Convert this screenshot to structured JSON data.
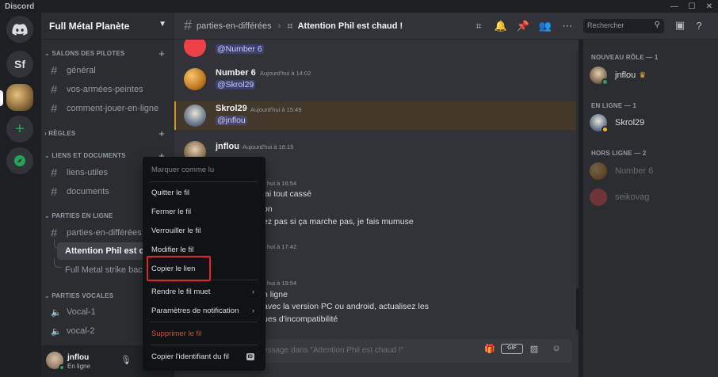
{
  "app": {
    "name": "Discord"
  },
  "window_controls": [
    "—",
    "☐",
    "✕"
  ],
  "rail": {
    "home_icon": "discord-logo-icon",
    "servers": [
      {
        "initials": "Sf"
      },
      {
        "initials": ""
      }
    ],
    "add_icon": "+",
    "explore_icon": "compass-icon"
  },
  "guild": {
    "name": "Full Métal Planète"
  },
  "categories": [
    {
      "label": "SALONS DES PILOTES"
    },
    {
      "label": "RÈGLES"
    },
    {
      "label": "LIENS ET DOCUMENTS"
    },
    {
      "label": "PARTIES EN LIGNE"
    },
    {
      "label": "PARTIES VOCALES"
    }
  ],
  "channels": {
    "pilotes": [
      "général",
      "vos-armées-peintes",
      "comment-jouer-en-ligne"
    ],
    "liens": [
      "liens-utiles",
      "documents"
    ],
    "parties": [
      "parties-en-différées"
    ],
    "threads": [
      "Attention Phil est chaud !",
      "Full Metal strike back"
    ],
    "vocal": [
      "Vocal-1",
      "vocal-2"
    ]
  },
  "user": {
    "name": "jnflou",
    "status": "En ligne"
  },
  "header": {
    "parent_channel": "parties-en-différées",
    "thread_title": "Attention Phil est chaud !",
    "search_placeholder": "Rechercher"
  },
  "messages": [
    {
      "author": "",
      "time": "",
      "text": "@Number 6",
      "mention": true
    },
    {
      "author": "Number 6",
      "time": "Aujourd'hui à 14:02",
      "text": "@Skrol29",
      "mention": true
    },
    {
      "author": "Skrol29",
      "time": "Aujourd'hui à 15:49",
      "text": "@jnflou",
      "mention": true
    },
    {
      "author": "jnflou",
      "time": "Aujourd'hui à 16:15",
      "text": "",
      "mention": false
    }
  ],
  "partial_messages": [
    {
      "time": "hui à 16:54"
    },
    {
      "text": "'ai tout cassé"
    },
    {
      "text": "on"
    },
    {
      "text": "ez pas si ça marche pas, je fais mumuse"
    },
    {
      "time": "hui à 17:42"
    },
    {
      "time": "hui à 19:54"
    },
    {
      "text": "n ligne"
    },
    {
      "text": "avec la version PC ou android, actualisez les"
    },
    {
      "text": "ues d'incompatibilité"
    }
  ],
  "composer": {
    "placeholder": "essage dans \"Attention Phil est chaud !\""
  },
  "members": {
    "groups": [
      {
        "label": "NOUVEAU RÔLE — 1",
        "members": [
          {
            "name": "jnflou"
          }
        ]
      },
      {
        "label": "EN LIGNE — 1",
        "members": [
          {
            "name": "Skrol29"
          }
        ]
      },
      {
        "label": "HORS LIGNE — 2",
        "members": [
          {
            "name": "Number 6"
          },
          {
            "name": "seikovag"
          }
        ]
      }
    ]
  },
  "context_menu": {
    "items": [
      {
        "label": "Marquer comme lu",
        "type": "disabled"
      },
      {
        "label": "Quitter le fil"
      },
      {
        "label": "Fermer le fil"
      },
      {
        "label": "Verrouiller le fil"
      },
      {
        "label": "Modifier le fil"
      },
      {
        "label": "Copier le lien"
      },
      {
        "label": "Rendre le fil muet",
        "submenu": true
      },
      {
        "label": "Paramètres de notification",
        "submenu": true
      },
      {
        "label": "Supprimer le fil",
        "type": "danger"
      },
      {
        "label": "Copier l'identifiant du fil",
        "badge": "ID"
      }
    ]
  },
  "colors": {
    "accent_mention": "#5865f2",
    "highlight_border": "#e0242b",
    "online": "#23a559",
    "danger": "#f23f43"
  }
}
